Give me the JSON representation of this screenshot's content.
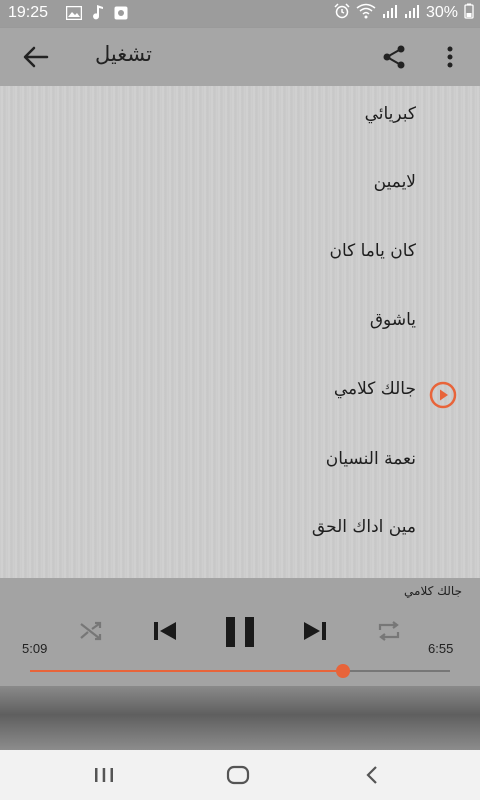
{
  "status_bar": {
    "time": "19:25",
    "battery_percent": "30%",
    "icons_left": [
      "image-icon",
      "music-note-icon",
      "record-icon"
    ],
    "icons_right": [
      "alarm-icon",
      "wifi-icon",
      "signal-icon",
      "signal-icon",
      "battery-icon"
    ]
  },
  "app_bar": {
    "title": "تشغيل",
    "back_icon": "arrow-left-icon",
    "share_icon": "share-icon",
    "menu_icon": "more-vert-icon"
  },
  "tracks": [
    {
      "label": "كبريائي",
      "playing": false
    },
    {
      "label": "لايمين",
      "playing": false
    },
    {
      "label": "كان ياما كان",
      "playing": false
    },
    {
      "label": "ياشوق",
      "playing": false
    },
    {
      "label": "جالك كلامي",
      "playing": true
    },
    {
      "label": "نعمة النسيان",
      "playing": false
    },
    {
      "label": "مين اداك الحق",
      "playing": false
    }
  ],
  "player": {
    "now_playing": "جالك كلامي",
    "elapsed": "5:09",
    "total": "6:55",
    "progress_fraction": 0.745,
    "controls": [
      "shuffle-icon",
      "skip-previous-icon",
      "pause-icon",
      "skip-next-icon",
      "repeat-icon"
    ]
  },
  "colors": {
    "accent": "#e8643a",
    "app_bar": "#a6a6a6",
    "status_bar": "#9c9c9c"
  },
  "nav_bar": {
    "icons": [
      "recent-apps-icon",
      "home-icon",
      "back-icon"
    ]
  }
}
